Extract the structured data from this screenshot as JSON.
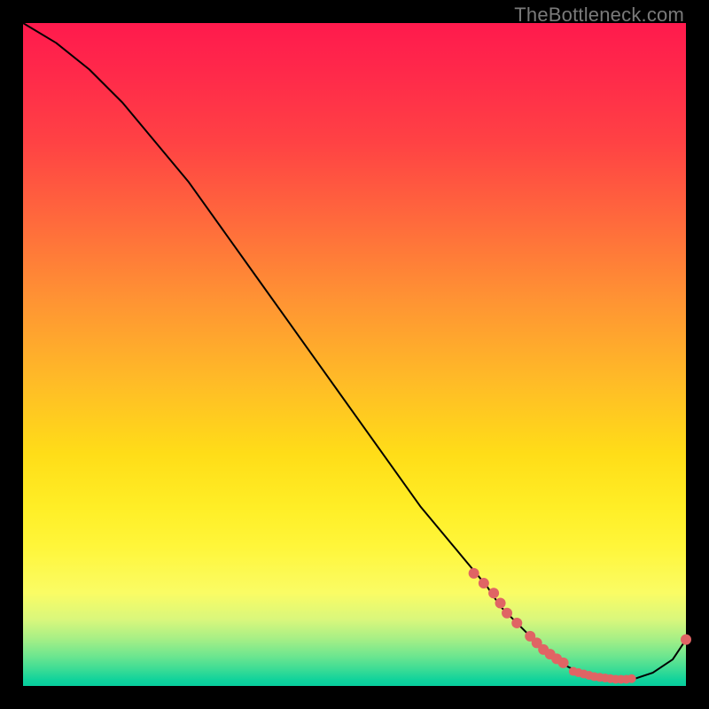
{
  "watermark": "TheBottleneck.com",
  "chart_data": {
    "type": "line",
    "title": "",
    "xlabel": "",
    "ylabel": "",
    "xlim": [
      0,
      100
    ],
    "ylim": [
      0,
      100
    ],
    "grid": false,
    "legend": false,
    "series": [
      {
        "name": "bottleneck-curve",
        "color": "#000000",
        "x": [
          0,
          5,
          10,
          15,
          20,
          25,
          30,
          35,
          40,
          45,
          50,
          55,
          60,
          65,
          70,
          72,
          75,
          78,
          80,
          83,
          86,
          89,
          92,
          95,
          98,
          100
        ],
        "y": [
          100,
          97,
          93,
          88,
          82,
          76,
          69,
          62,
          55,
          48,
          41,
          34,
          27,
          21,
          15,
          12,
          9,
          6,
          4,
          2.5,
          1.5,
          1,
          1,
          2,
          4,
          7
        ]
      }
    ],
    "markers": [
      {
        "name": "segment-upper",
        "color": "#e06464",
        "radius": 6,
        "points": [
          {
            "x": 68,
            "y": 17
          },
          {
            "x": 69.5,
            "y": 15.5
          },
          {
            "x": 71,
            "y": 14
          },
          {
            "x": 72,
            "y": 12.5
          },
          {
            "x": 73,
            "y": 11
          },
          {
            "x": 74.5,
            "y": 9.5
          }
        ]
      },
      {
        "name": "segment-lower",
        "color": "#e06464",
        "radius": 6,
        "points": [
          {
            "x": 76.5,
            "y": 7.5
          },
          {
            "x": 77.5,
            "y": 6.5
          },
          {
            "x": 78.5,
            "y": 5.5
          },
          {
            "x": 79.5,
            "y": 4.8
          },
          {
            "x": 80.5,
            "y": 4.1
          },
          {
            "x": 81.5,
            "y": 3.5
          }
        ]
      },
      {
        "name": "bottom-cluster",
        "color": "#e06464",
        "radius": 5,
        "points": [
          {
            "x": 83,
            "y": 2.2
          },
          {
            "x": 83.8,
            "y": 2.0
          },
          {
            "x": 84.6,
            "y": 1.8
          },
          {
            "x": 85.4,
            "y": 1.6
          },
          {
            "x": 86.2,
            "y": 1.4
          },
          {
            "x": 87.0,
            "y": 1.3
          },
          {
            "x": 87.8,
            "y": 1.2
          },
          {
            "x": 88.6,
            "y": 1.1
          },
          {
            "x": 89.4,
            "y": 1.0
          },
          {
            "x": 90.2,
            "y": 1.0
          },
          {
            "x": 91.0,
            "y": 1.0
          },
          {
            "x": 91.8,
            "y": 1.1
          }
        ]
      },
      {
        "name": "end-point",
        "color": "#e06464",
        "radius": 6,
        "points": [
          {
            "x": 100,
            "y": 7
          }
        ]
      }
    ]
  }
}
